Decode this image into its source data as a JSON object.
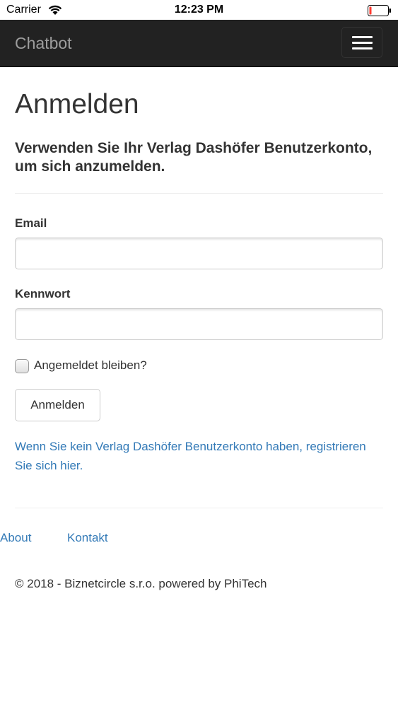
{
  "status_bar": {
    "carrier": "Carrier",
    "time": "12:23 PM"
  },
  "navbar": {
    "brand": "Chatbot",
    "menu_icon": "hamburger-menu-icon"
  },
  "login": {
    "title": "Anmelden",
    "subtitle": "Verwenden Sie Ihr Verlag Dashöfer Benutzerkonto, um sich anzumelden.",
    "email_label": "Email",
    "email_value": "",
    "password_label": "Kennwort",
    "password_value": "",
    "remember_label": "Angemeldet bleiben?",
    "remember_checked": false,
    "submit_label": "Anmelden",
    "register_text": "Wenn Sie kein Verlag Dashöfer Benutzerkonto haben, registrieren Sie sich hier."
  },
  "footer": {
    "links": [
      "About",
      "Kontakt"
    ],
    "copyright": "© 2018 - Biznetcircle s.r.o. powered by PhiTech"
  },
  "colors": {
    "navbar_bg": "#222222",
    "brand_text": "#9d9d9d",
    "link": "#337ab7",
    "battery_low": "#ff3b30"
  }
}
